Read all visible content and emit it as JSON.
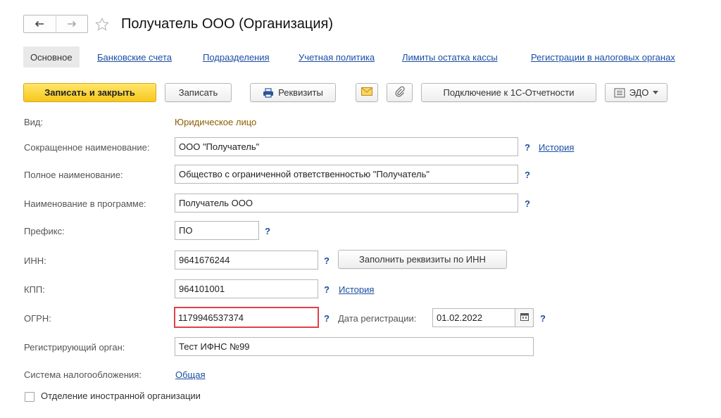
{
  "window": {
    "title": "Получатель ООО (Организация)"
  },
  "tabs": {
    "active": "Основное",
    "links": [
      "Банковские счета",
      "Подразделения",
      "Учетная политика",
      "Лимиты остатка кассы",
      "Регистрации в налоговых органах"
    ]
  },
  "toolbar": {
    "save_close": "Записать и закрыть",
    "save": "Записать",
    "requisites": "Реквизиты",
    "connect": "Подключение к 1С-Отчетности",
    "edo": "ЭДО"
  },
  "form": {
    "vid_label": "Вид:",
    "vid_value": "Юридическое лицо",
    "short_name_label": "Сокращенное наименование:",
    "short_name_value": "ООО \"Получатель\"",
    "full_name_label": "Полное наименование:",
    "full_name_value": "Общество с ограниченной ответственностью \"Получатель\"",
    "program_name_label": "Наименование в программе:",
    "program_name_value": "Получатель ООО",
    "prefix_label": "Префикс:",
    "prefix_value": "ПО",
    "inn_label": "ИНН:",
    "inn_value": "9641676244",
    "fill_by_inn": "Заполнить реквизиты по ИНН",
    "kpp_label": "КПП:",
    "kpp_value": "964101001",
    "ogrn_label": "ОГРН:",
    "ogrn_value": "1179946537374",
    "reg_date_label": "Дата регистрации:",
    "reg_date_value": "01.02.2022",
    "reg_body_label": "Регистрирующий орган:",
    "reg_body_value": "Тест ИФНС №99",
    "tax_system_label": "Система налогообложения:",
    "tax_system_value": "Общая",
    "foreign_branch_label": "Отделение иностранной организации",
    "help": "?",
    "history": "История"
  },
  "colors": {
    "accent_yellow": "#f6c81c",
    "link_blue": "#1a4ea2",
    "highlight_red": "#e0404a",
    "value_brown": "#8c5d00"
  }
}
